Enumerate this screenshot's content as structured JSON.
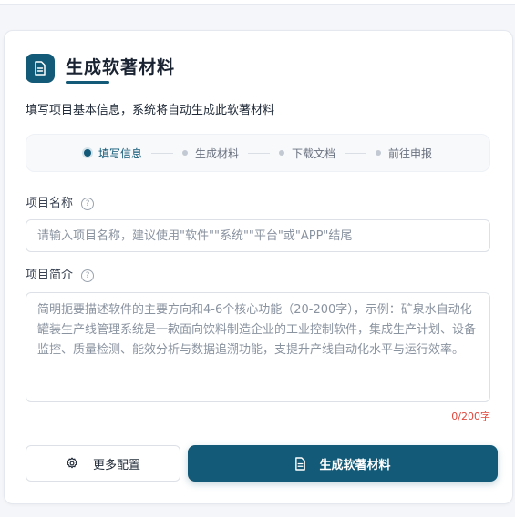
{
  "card": {
    "title": "生成软著材料",
    "description": "填写项目基本信息，系统将自动生成此软著材料"
  },
  "steps": [
    {
      "label": "填写信息",
      "active": true
    },
    {
      "label": "生成材料",
      "active": false
    },
    {
      "label": "下载文档",
      "active": false
    },
    {
      "label": "前往申报",
      "active": false
    }
  ],
  "project_name": {
    "label": "项目名称",
    "help": "?",
    "value": "",
    "placeholder": "请输入项目名称，建议使用\"软件\"\"系统\"\"平台\"或\"APP\"结尾"
  },
  "project_intro": {
    "label": "项目简介",
    "help": "?",
    "value": "",
    "placeholder": "简明扼要描述软件的主要方向和4-6个核心功能（20-200字），示例：矿泉水自动化罐装生产线管理系统是一款面向饮料制造企业的工业控制软件，集成生产计划、设备监控、质量检测、能效分析与数据追溯功能，支提升产线自动化水平与运行效率。",
    "char_count": "0/200字"
  },
  "buttons": {
    "config_label": "更多配置",
    "generate_label": "生成软著材料"
  },
  "icons": {
    "logo": "document-icon",
    "config": "gear-icon",
    "generate": "document-icon"
  },
  "colors": {
    "primary": "#135a78",
    "counter": "#e0483e"
  }
}
